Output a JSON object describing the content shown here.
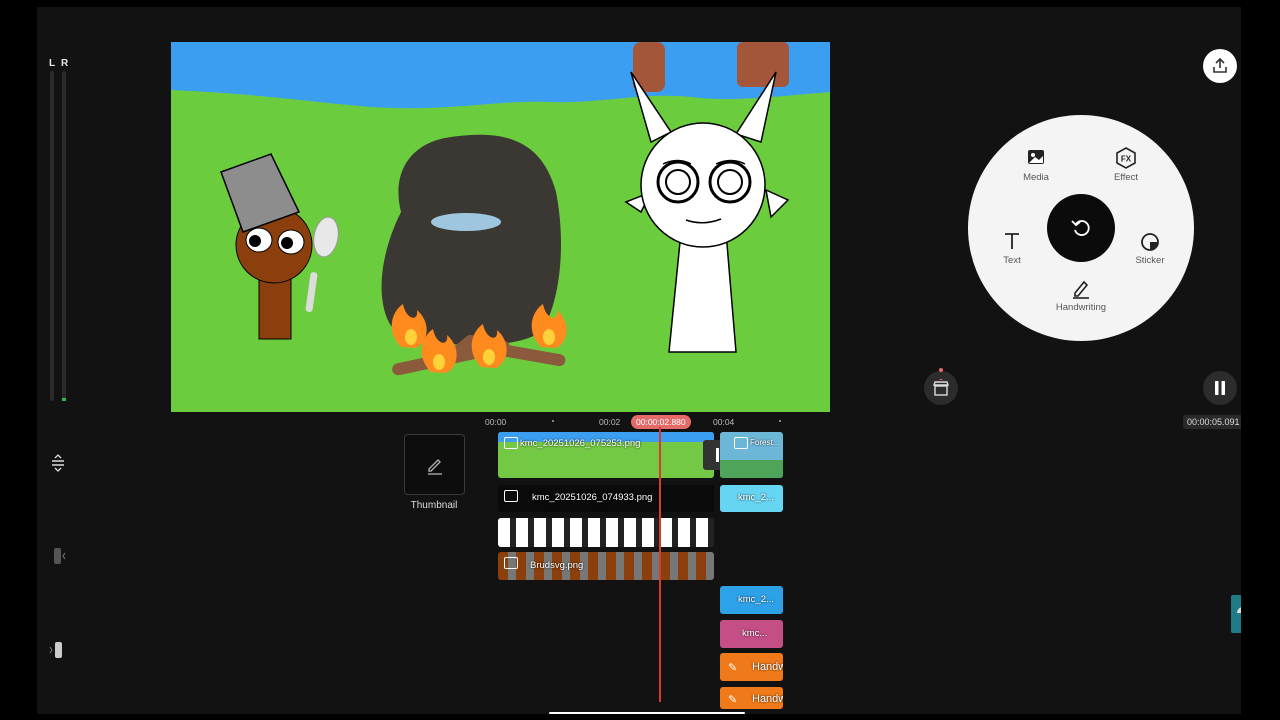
{
  "audio_meter": {
    "left_label": "L",
    "right_label": "R"
  },
  "radial_menu": {
    "items": [
      {
        "label": "Media",
        "icon": "image-icon"
      },
      {
        "label": "Effect",
        "icon": "fx-icon"
      },
      {
        "label": "Text",
        "icon": "text-icon"
      },
      {
        "label": "Sticker",
        "icon": "sticker-icon"
      },
      {
        "label": "Handwriting",
        "icon": "pen-icon"
      }
    ],
    "center_icon": "undo-icon"
  },
  "total_time": "00:00:05.091",
  "timeline": {
    "ruler": [
      "00:00",
      "00:02",
      "00:04"
    ],
    "playhead_time": "00:00:02.880",
    "thumbnail_label": "Thumbnail",
    "clips": {
      "bg_clip": "kmc_20251026_075253.png",
      "pot_clip": "kmc_20251026_074933.png",
      "brud_clip": "Brudsvg.png",
      "right_clip_1": "Forest...",
      "right_clip_2": "kmc_2...",
      "right_clip_3": "kmc_2...",
      "right_clip_4": "kmc...",
      "handwriting_1": "Handw",
      "handwriting_2": "Handw"
    }
  },
  "colors": {
    "accent": "#e56b6b",
    "handwriting_clip": "#f07a1a",
    "playhead": "#d93a2f"
  }
}
